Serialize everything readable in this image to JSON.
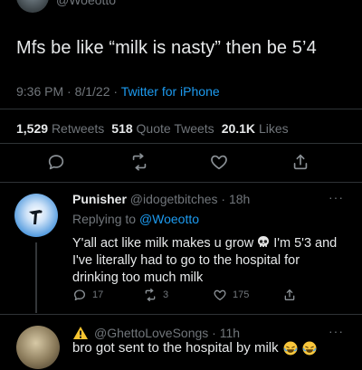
{
  "main_tweet": {
    "handle_partial": "@Woeotto",
    "text": "Mfs be like “milk is nasty” then be 5’4",
    "time": "9:36 PM · 8/1/22 · ",
    "source": "Twitter for iPhone",
    "stats": {
      "retweets_count": "1,529",
      "retweets_label": "Retweets",
      "quote_count": "518",
      "quote_label": "Quote Tweets",
      "likes_count": "20.1K",
      "likes_label": "Likes"
    }
  },
  "reply": {
    "name": "Punisher",
    "handle_time": "@idogetbitches · 18h",
    "more": "···",
    "replying_label": "Replying to ",
    "replying_to": "@Woeotto",
    "text_a": "Y'all act like milk makes u grow",
    "text_b": "I'm 5'3 and I've literally had to go to the hospital for drinking too much milk",
    "actions": {
      "replies": "17",
      "retweets": "3",
      "likes": "175"
    }
  },
  "third": {
    "handle_time": "@GhettoLoveSongs · 11h",
    "more": "···",
    "text": "bro got sent to the hospital by milk"
  },
  "colors": {
    "background": "#000000",
    "text": "#e7e9ea",
    "muted": "#71767b",
    "link": "#1d9bf0",
    "divider": "#2f3336"
  }
}
